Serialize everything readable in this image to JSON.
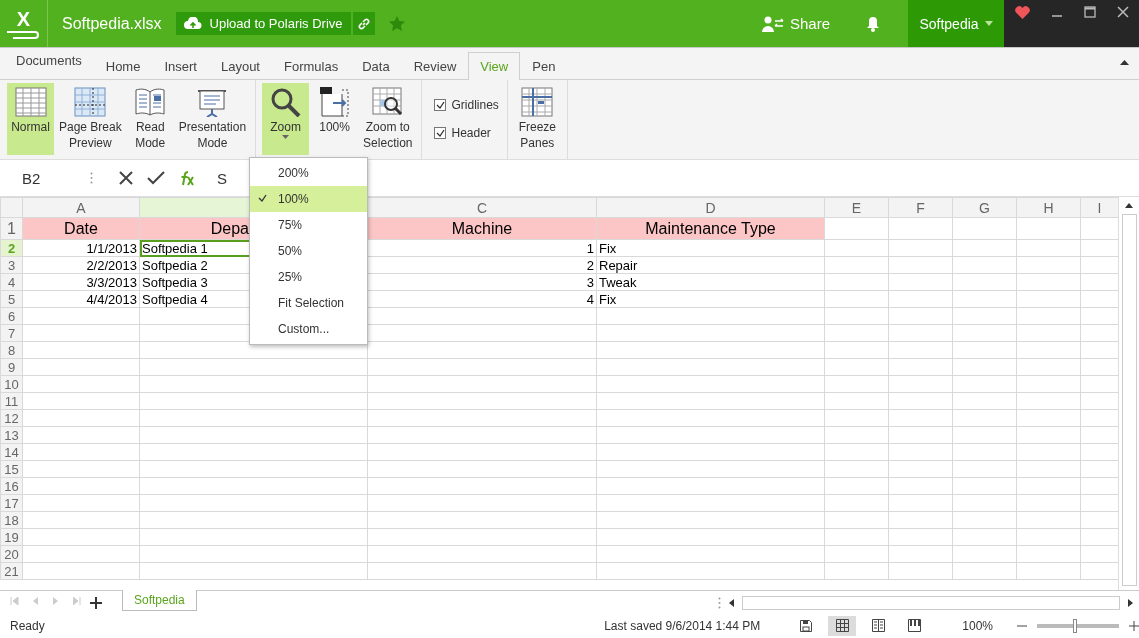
{
  "title_bar": {
    "logo": "X",
    "file_name": "Softpedia.xlsx",
    "upload_button": "Upload to Polaris Drive",
    "share_button": "Share",
    "user_menu": "Softpedia"
  },
  "ribbon_tabs": [
    {
      "label": "Documents",
      "selected": false
    },
    {
      "label": "Home",
      "selected": false
    },
    {
      "label": "Insert",
      "selected": false
    },
    {
      "label": "Layout",
      "selected": false
    },
    {
      "label": "Formulas",
      "selected": false
    },
    {
      "label": "Data",
      "selected": false
    },
    {
      "label": "Review",
      "selected": false
    },
    {
      "label": "View",
      "selected": true
    },
    {
      "label": "Pen",
      "selected": false
    }
  ],
  "ribbon_groups": [
    {
      "items": [
        {
          "kind": "large",
          "lines": [
            "Normal"
          ],
          "selected": true
        },
        {
          "kind": "large",
          "lines": [
            "Page Break",
            "Preview"
          ],
          "selected": false
        },
        {
          "kind": "large",
          "lines": [
            "Read",
            "Mode"
          ],
          "selected": false
        },
        {
          "kind": "large",
          "lines": [
            "Presentation",
            "Mode"
          ],
          "selected": false
        }
      ]
    },
    {
      "items": [
        {
          "kind": "dropdown",
          "lines": [
            "Zoom"
          ],
          "selected": true
        },
        {
          "kind": "large",
          "lines": [
            "100%"
          ],
          "selected": false
        },
        {
          "kind": "large",
          "lines": [
            "Zoom to",
            "Selection"
          ],
          "selected": false
        }
      ]
    },
    {
      "items": [
        {
          "kind": "check",
          "lines": [
            "Gridlines"
          ],
          "checked": true
        },
        {
          "kind": "check",
          "lines": [
            "Header"
          ],
          "checked": true
        }
      ]
    },
    {
      "items": [
        {
          "kind": "large",
          "lines": [
            "Freeze",
            "Panes"
          ],
          "selected": false
        }
      ]
    }
  ],
  "formula_bar": {
    "cell_name": "B2",
    "value": "S"
  },
  "zoom_menu": [
    {
      "label": "200%",
      "selected": false
    },
    {
      "label": "100%",
      "selected": true
    },
    {
      "label": "75%",
      "selected": false
    },
    {
      "label": "50%",
      "selected": false
    },
    {
      "label": "25%",
      "selected": false
    },
    {
      "label": "Fit Selection",
      "selected": false
    },
    {
      "label": "Custom...",
      "selected": false
    }
  ],
  "sheet": {
    "columns": [
      {
        "label": "A",
        "selected": false
      },
      {
        "selected": true
      },
      {
        "label": "C",
        "selected": false
      },
      {
        "label": "D",
        "selected": false
      },
      {
        "label": "E",
        "selected": false
      },
      {
        "label": "F",
        "selected": false
      },
      {
        "label": "G",
        "selected": false
      },
      {
        "label": "H",
        "selected": false
      },
      {
        "label": "I",
        "selected": false
      }
    ],
    "rows": [
      {
        "number": "1",
        "kind": "header",
        "selected": false,
        "cells": [
          "Date",
          "Depa",
          "Machine",
          "Maintenance Type"
        ]
      },
      {
        "number": "2",
        "kind": "data",
        "selected": true,
        "cells": [
          "1/1/2013",
          "Softpedia 1",
          "1",
          "Fix"
        ]
      },
      {
        "number": "3",
        "kind": "data",
        "selected": false,
        "cells": [
          "2/2/2013",
          "Softpedia 2",
          "2",
          "Repair"
        ]
      },
      {
        "number": "4",
        "kind": "data",
        "selected": false,
        "cells": [
          "3/3/2013",
          "Softpedia 3",
          "3",
          "Tweak"
        ]
      },
      {
        "number": "5",
        "kind": "data",
        "selected": false,
        "cells": [
          "4/4/2013",
          "Softpedia 4",
          "4",
          "Fix"
        ]
      },
      {
        "number": "6",
        "kind": "data",
        "selected": false,
        "cells": []
      },
      {
        "number": "7",
        "kind": "data",
        "selected": false,
        "cells": []
      },
      {
        "number": "8",
        "kind": "data",
        "selected": false,
        "cells": []
      },
      {
        "number": "9",
        "kind": "data",
        "selected": false,
        "cells": []
      },
      {
        "number": "10",
        "kind": "data",
        "selected": false,
        "cells": []
      },
      {
        "number": "11",
        "kind": "data",
        "selected": false,
        "cells": []
      },
      {
        "number": "12",
        "kind": "data",
        "selected": false,
        "cells": []
      },
      {
        "number": "13",
        "kind": "data",
        "selected": false,
        "cells": []
      },
      {
        "number": "14",
        "kind": "data",
        "selected": false,
        "cells": []
      },
      {
        "number": "15",
        "kind": "data",
        "selected": false,
        "cells": []
      },
      {
        "number": "16",
        "kind": "data",
        "selected": false,
        "cells": []
      },
      {
        "number": "17",
        "kind": "data",
        "selected": false,
        "cells": []
      },
      {
        "number": "18",
        "kind": "data",
        "selected": false,
        "cells": []
      },
      {
        "number": "19",
        "kind": "data",
        "selected": false,
        "cells": []
      },
      {
        "number": "20",
        "kind": "data",
        "selected": false,
        "cells": []
      },
      {
        "number": "21",
        "kind": "data",
        "selected": false,
        "cells": []
      }
    ]
  },
  "sheet_tabs": [
    {
      "label": "Softpedia",
      "selected": true
    }
  ],
  "status_bar": {
    "status": "Ready",
    "last_saved": "Last saved 9/6/2014 1:44 PM",
    "views": [
      {
        "selected": true
      },
      {
        "selected": false
      },
      {
        "selected": false
      }
    ],
    "zoom": "100%",
    "zoom_slider": {
      "level": 0.47
    }
  }
}
